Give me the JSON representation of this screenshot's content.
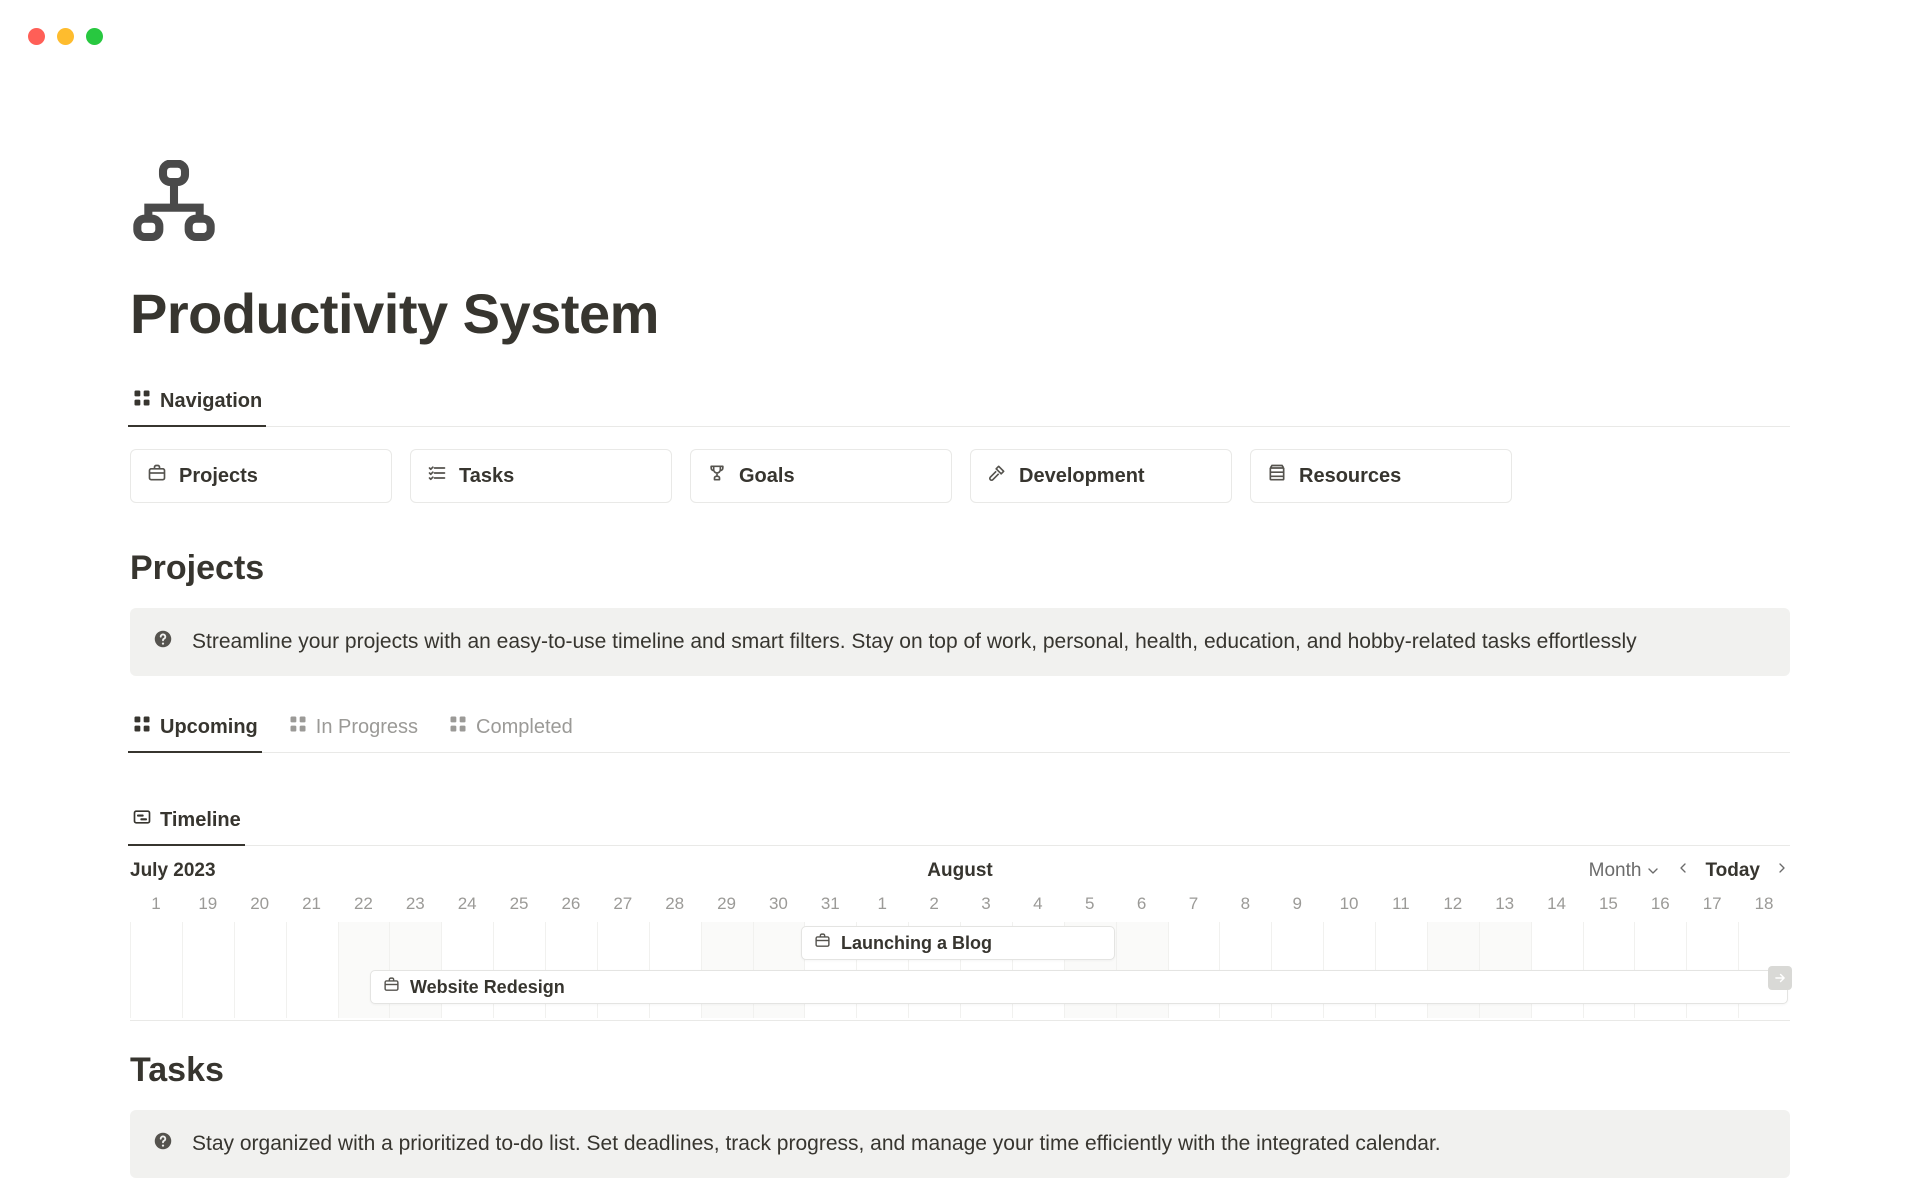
{
  "page": {
    "title": "Productivity System"
  },
  "viewTabs": {
    "navigation": "Navigation"
  },
  "navCards": [
    {
      "label": "Projects",
      "icon": "briefcase"
    },
    {
      "label": "Tasks",
      "icon": "checklist"
    },
    {
      "label": "Goals",
      "icon": "trophy"
    },
    {
      "label": "Development",
      "icon": "hammer"
    },
    {
      "label": "Resources",
      "icon": "stack"
    }
  ],
  "projects": {
    "heading": "Projects",
    "callout": "Streamline your projects with an easy-to-use timeline and smart filters. Stay on top of work, personal, health, education, and hobby-related tasks effortlessly",
    "statusTabs": [
      "Upcoming",
      "In Progress",
      "Completed"
    ],
    "timelineTab": "Timeline",
    "timelineHeader": {
      "left": "July 2023",
      "center": "August",
      "scale": "Month",
      "today": "Today"
    },
    "days": [
      "1",
      "19",
      "20",
      "21",
      "22",
      "23",
      "24",
      "25",
      "26",
      "27",
      "28",
      "29",
      "30",
      "31",
      "1",
      "2",
      "3",
      "4",
      "5",
      "6",
      "7",
      "8",
      "9",
      "10",
      "11",
      "12",
      "13",
      "14",
      "15",
      "16",
      "17",
      "18"
    ],
    "bars": [
      {
        "label": "Launching a Blog"
      },
      {
        "label": "Website Redesign"
      }
    ]
  },
  "tasks": {
    "heading": "Tasks",
    "callout": "Stay organized with a prioritized to-do list. Set deadlines, track progress, and manage your time efficiently with the integrated calendar."
  }
}
